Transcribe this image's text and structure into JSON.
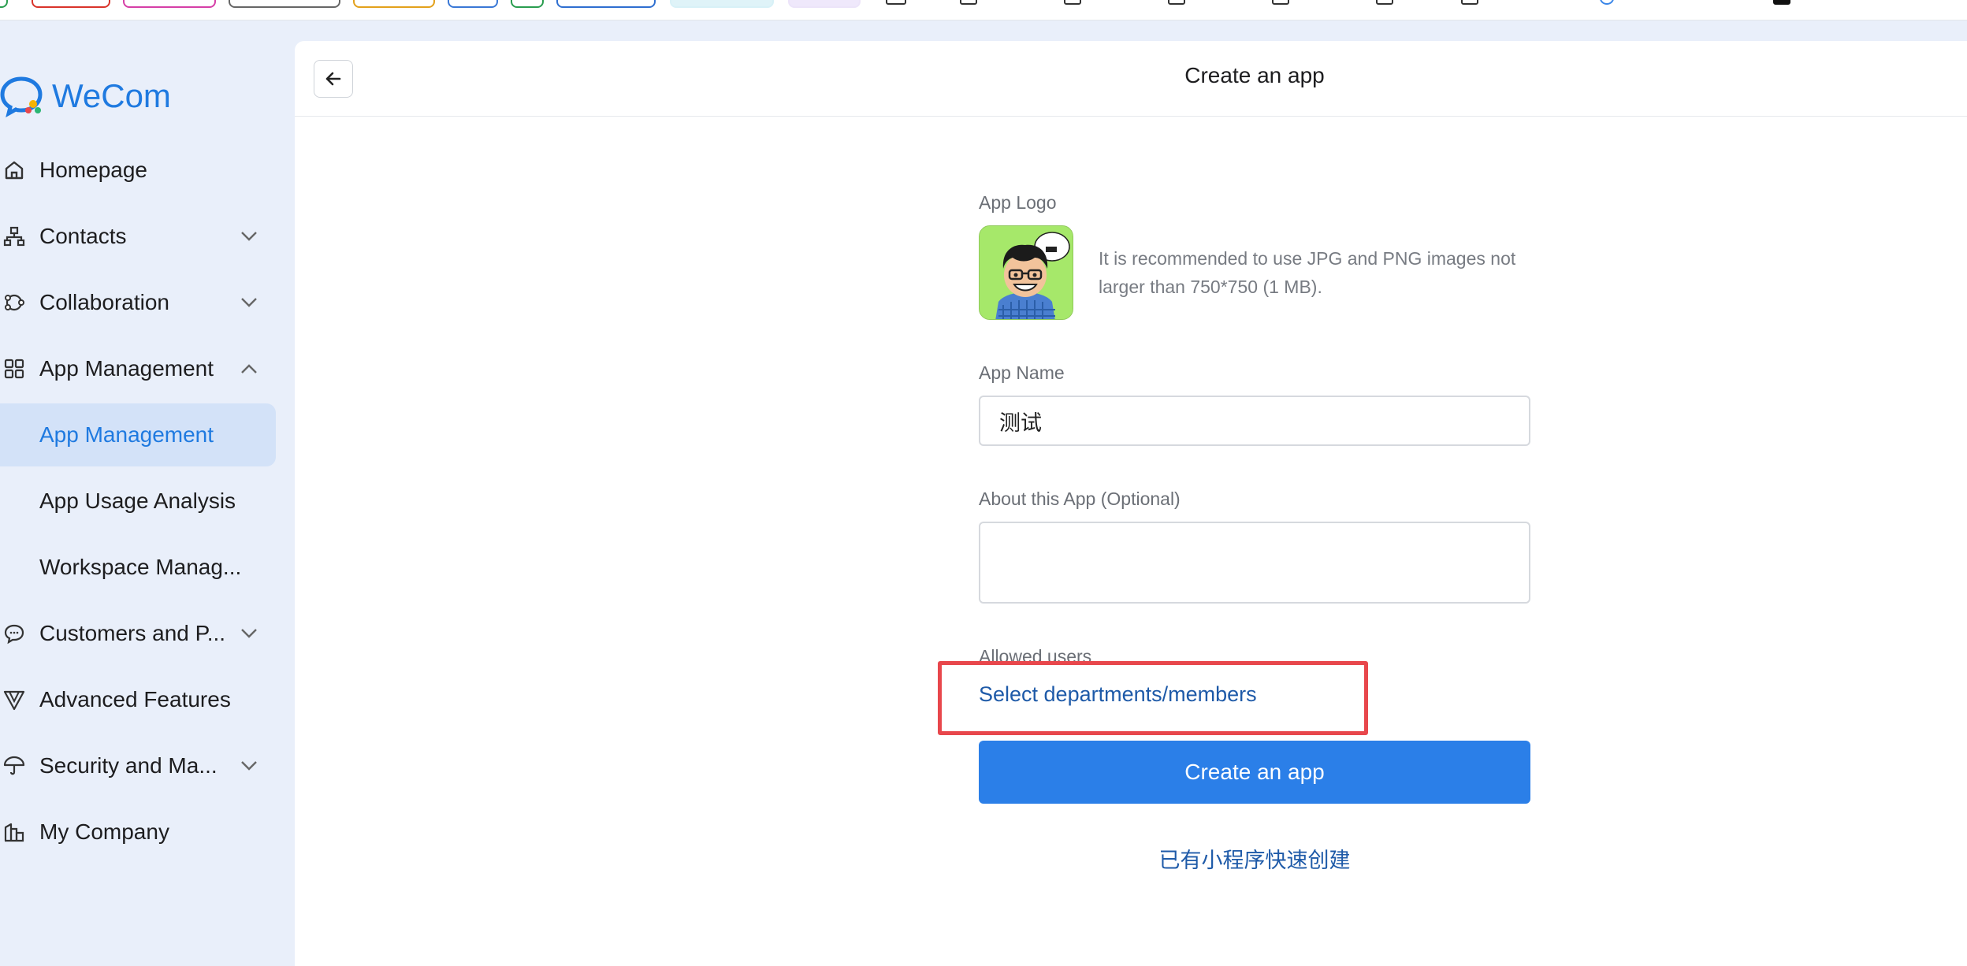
{
  "app": {
    "brand": "WeCom",
    "brand_color": "#1f7ae0"
  },
  "sidebar": {
    "items": [
      {
        "label": "Homepage",
        "icon": "home-icon",
        "chevron": "none"
      },
      {
        "label": "Contacts",
        "icon": "org-chart-icon",
        "chevron": "down"
      },
      {
        "label": "Collaboration",
        "icon": "collaboration-icon",
        "chevron": "down"
      },
      {
        "label": "App Management",
        "icon": "grid-apps-icon",
        "chevron": "up"
      },
      {
        "label": "App Management",
        "icon": "",
        "chevron": "none",
        "active": true,
        "sub": true
      },
      {
        "label": "App Usage Analysis",
        "icon": "",
        "chevron": "none",
        "sub": true
      },
      {
        "label": "Workspace Manag...",
        "icon": "",
        "chevron": "none",
        "sub": true
      },
      {
        "label": "Customers and P...",
        "icon": "chat-bubble-icon",
        "chevron": "down"
      },
      {
        "label": "Advanced Features",
        "icon": "filter-v-icon",
        "chevron": "none"
      },
      {
        "label": "Security and Ma...",
        "icon": "umbrella-icon",
        "chevron": "down"
      },
      {
        "label": "My Company",
        "icon": "building-icon",
        "chevron": "none"
      }
    ],
    "active_color": "#1f7ae0",
    "active_bg": "#d3e2f8"
  },
  "header": {
    "title": "Create an app",
    "back_icon": "arrow-left-icon"
  },
  "form": {
    "logo_label": "App Logo",
    "logo_hint": "It is recommended to use JPG and PNG images not larger than 750*750 (1 MB).",
    "name_label": "App Name",
    "name_value": "测试",
    "about_label": "About this App (Optional)",
    "about_value": "",
    "allowed_label": "Allowed users",
    "select_link": "Select departments/members",
    "submit_label": "Create an app",
    "quick_link": "已有小程序快速创建",
    "primary_color": "#2b7fe8",
    "highlight_color": "#e8474c"
  }
}
